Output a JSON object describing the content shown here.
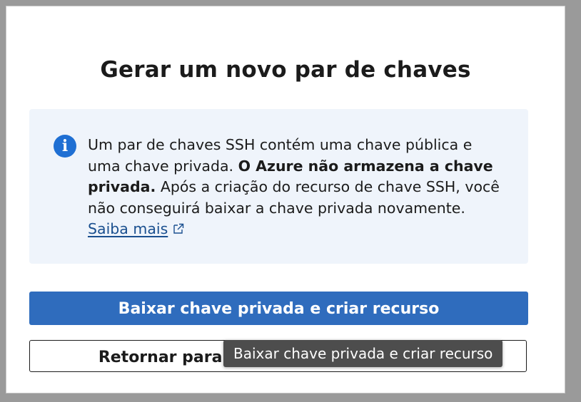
{
  "dialog": {
    "title": "Gerar um novo par de chaves",
    "info": {
      "icon": "info-icon",
      "text_part1": "Um par de chaves SSH contém uma chave pública e uma chave privada. ",
      "text_bold": "O Azure não armazena a chave privada.",
      "text_part2": " Após a criação do recurso de chave SSH, você não conseguirá baixar a chave privada novamente.",
      "link_label": "Saiba mais",
      "link_icon": "external-link-icon"
    },
    "primary_button": "Baixar chave privada e criar recurso",
    "secondary_button": "Retornar para criar uma máquina virtual",
    "tooltip": "Baixar chave privada e criar recurso"
  },
  "colors": {
    "primary": "#2f6cbd",
    "info_background": "#eff4fb",
    "info_icon": "#1f6fd3",
    "link": "#1a4f8f",
    "tooltip_background": "#4d4d4d"
  }
}
